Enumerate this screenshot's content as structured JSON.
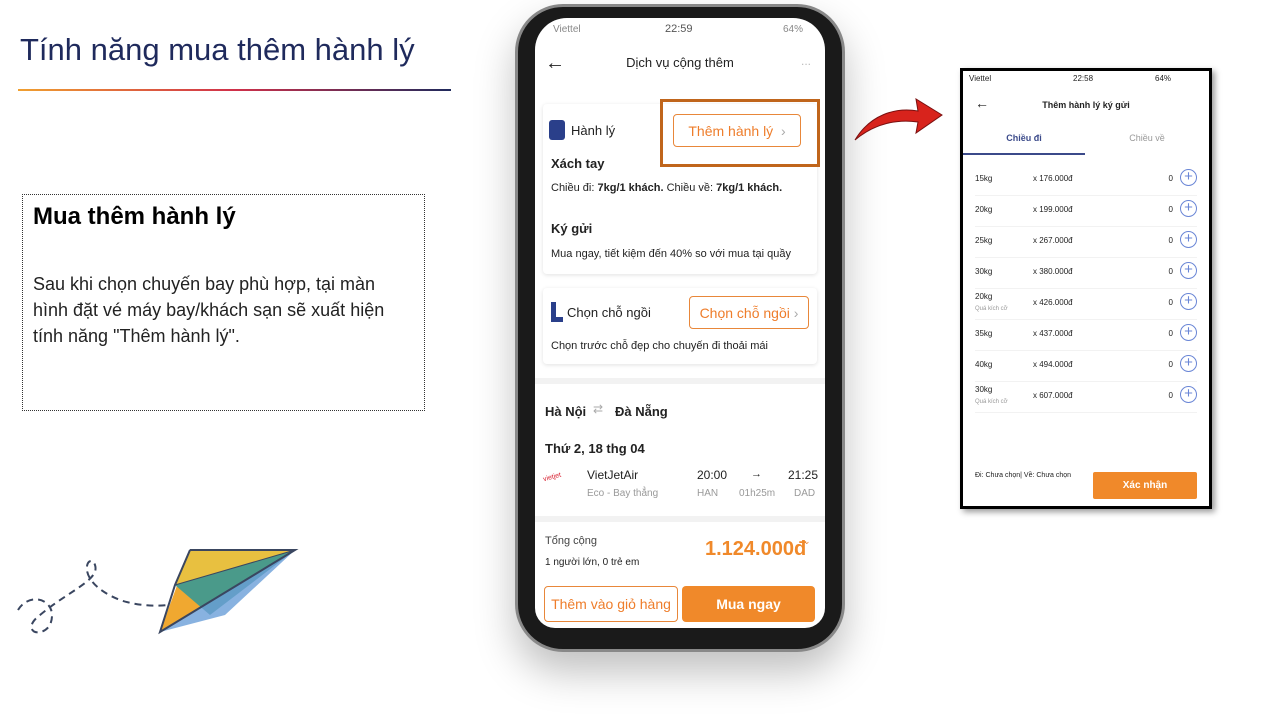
{
  "slide": {
    "title": "Tính năng mua thêm hành lý",
    "box_heading": "Mua thêm hành lý",
    "box_text": "Sau khi chọn chuyến bay phù hợp, tại màn hình đặt vé máy bay/khách sạn sẽ xuất hiện tính năng \"Thêm hành lý\"."
  },
  "colors": {
    "title": "#1f2a5c",
    "accent": "#f0892a",
    "highlight": "#c0651b",
    "arrow": "#d8231c",
    "tab": "#3b4a8a"
  },
  "phone1": {
    "status": {
      "carrier": "Viettel",
      "time": "22:59",
      "battery": "64%"
    },
    "header": "Dịch vụ cộng thêm",
    "more": "...",
    "baggage": {
      "label": "Hành lý",
      "button": "Thêm hành lý",
      "carry_title": "Xách tay",
      "carry_prefix": "Chiều đi: ",
      "carry_out": "7kg/1 khách.",
      "carry_mid": " Chiều về: ",
      "carry_ret": "7kg/1 khách.",
      "checked_title": "Ký gửi",
      "checked_text": "Mua ngay, tiết kiệm đến 40% so với mua tại quầy"
    },
    "seat": {
      "label": "Chọn chỗ ngồi",
      "button": "Chọn chỗ ngồi",
      "text": "Chọn trước chỗ đẹp cho chuyến đi thoải mái"
    },
    "flight": {
      "from": "Hà Nội",
      "to": "Đà Nẵng",
      "date": "Thứ 2, 18 thg 04",
      "airline": "VietJetAir",
      "class": "Eco - Bay thẳng",
      "dep_time": "20:00",
      "arr_time": "21:25",
      "dep_code": "HAN",
      "duration": "01h25m",
      "arr_code": "DAD"
    },
    "total": {
      "label": "Tổng cộng",
      "pax": "1 người lớn, 0 trẻ em",
      "price": "1.124.000đ"
    },
    "buttons": {
      "cart": "Thêm vào giỏ hàng",
      "buy": "Mua ngay"
    }
  },
  "phone2": {
    "status": {
      "carrier": "Viettel",
      "time": "22:58",
      "battery": "64%"
    },
    "header": "Thêm hành lý ký gửi",
    "tabs": [
      "Chiều đi",
      "Chiều về"
    ],
    "items": [
      {
        "kg": "15kg",
        "sub": "",
        "price": "x 176.000đ",
        "qty": "0"
      },
      {
        "kg": "20kg",
        "sub": "",
        "price": "x 199.000đ",
        "qty": "0"
      },
      {
        "kg": "25kg",
        "sub": "",
        "price": "x 267.000đ",
        "qty": "0"
      },
      {
        "kg": "30kg",
        "sub": "",
        "price": "x 380.000đ",
        "qty": "0"
      },
      {
        "kg": "20kg",
        "sub": "Quá kích cỡ",
        "price": "x 426.000đ",
        "qty": "0"
      },
      {
        "kg": "35kg",
        "sub": "",
        "price": "x 437.000đ",
        "qty": "0"
      },
      {
        "kg": "40kg",
        "sub": "",
        "price": "x 494.000đ",
        "qty": "0"
      },
      {
        "kg": "30kg",
        "sub": "Quá kích cỡ",
        "price": "x 607.000đ",
        "qty": "0"
      }
    ],
    "summary": "Đi: Chưa chọn| Về: Chưa chọn",
    "confirm": "Xác nhận"
  }
}
